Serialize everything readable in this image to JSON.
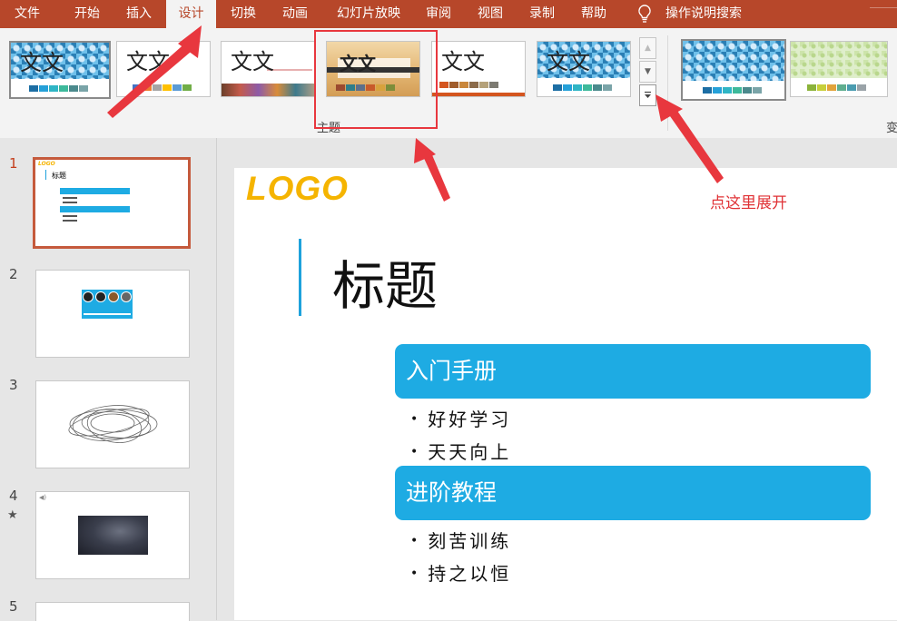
{
  "ribbon_tabs": [
    "文件",
    "开始",
    "插入",
    "设计",
    "切换",
    "动画",
    "幻灯片放映",
    "审阅",
    "视图",
    "录制",
    "帮助"
  ],
  "active_tab": "设计",
  "tell_me": "操作说明搜索",
  "theme_sample_text": "文文",
  "themes_group_label": "主题",
  "variants_group_label_partial": "变",
  "slide_numbers": [
    "1",
    "2",
    "3",
    "4",
    "5"
  ],
  "slide": {
    "logo": "LOGO",
    "title": "标题",
    "sections": [
      {
        "heading": "入门手册",
        "bullets": [
          "好好学习",
          "天天向上"
        ]
      },
      {
        "heading": "进阶教程",
        "bullets": [
          "刻苦训练",
          "持之以恒"
        ]
      }
    ]
  },
  "annotation": "点这里展开",
  "colors": {
    "ribbon_tab_bg": "#b7472a",
    "accent_blue": "#1eabe3",
    "logo_yellow": "#f5b400",
    "annotation_red": "#e8373e"
  }
}
